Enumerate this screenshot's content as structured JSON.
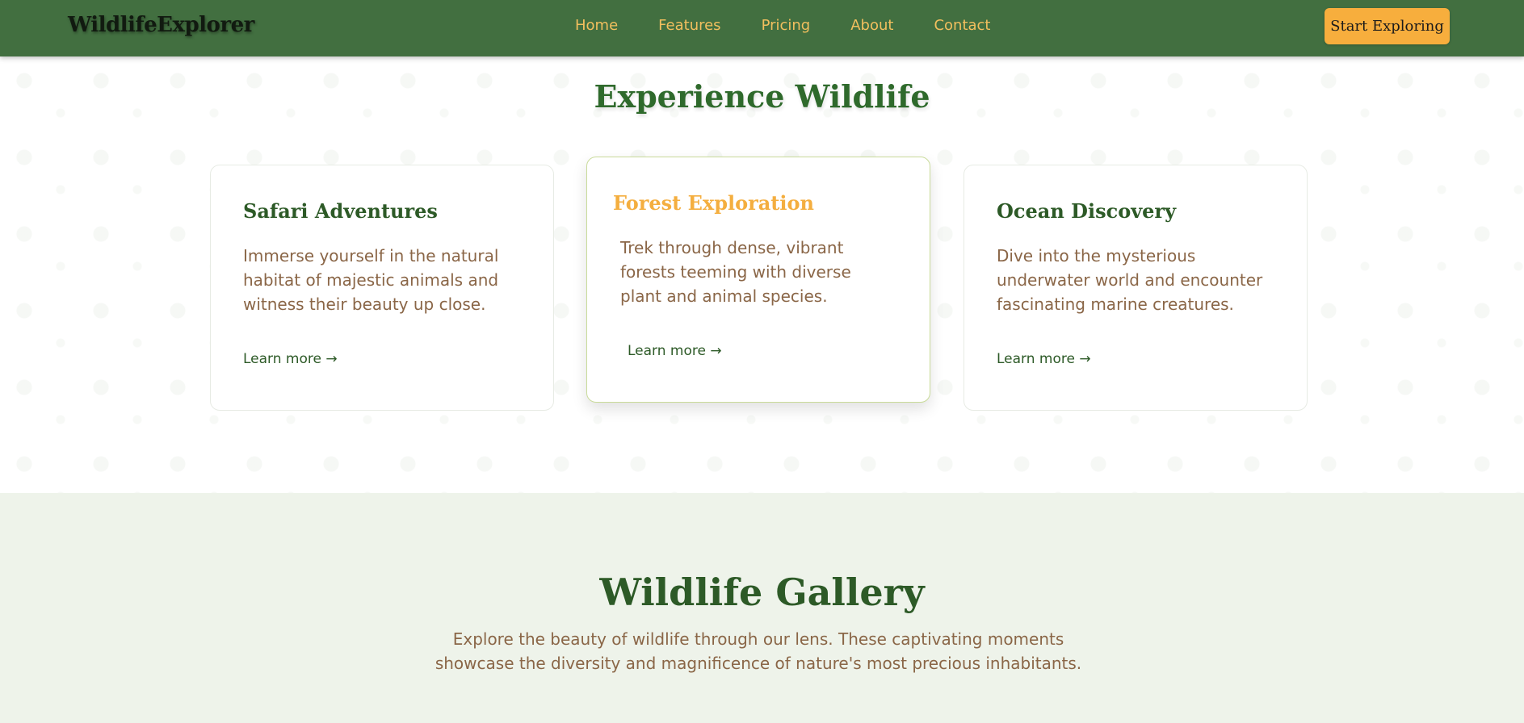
{
  "navbar": {
    "brand": "WildlifeExplorer",
    "links": [
      "Home",
      "Features",
      "Pricing",
      "About",
      "Contact"
    ],
    "cta_label": "Start Exploring"
  },
  "features": {
    "title": "Experience Wildlife",
    "cards": [
      {
        "title": "Safari Adventures",
        "description": "Immerse yourself in the natural habitat of majestic animals and witness their beauty up close.",
        "link": "Learn more →"
      },
      {
        "title": "Forest Exploration",
        "description": "Trek through dense, vibrant forests teeming with diverse plant and animal species.",
        "link": "Learn more →"
      },
      {
        "title": "Ocean Discovery",
        "description": "Dive into the mysterious underwater world and encounter fascinating marine creatures.",
        "link": "Learn more →"
      }
    ]
  },
  "gallery": {
    "title": "Wildlife Gallery",
    "description": "Explore the beauty of wildlife through our lens. These captivating moments showcase the diversity and magnificence of nature's most precious inhabitants."
  },
  "colors": {
    "nav_background": "#426f40",
    "accent": "#f7ae3d",
    "primary_green": "#2d5a27",
    "body_text": "#8a6647",
    "gallery_background": "#eef3ea"
  }
}
